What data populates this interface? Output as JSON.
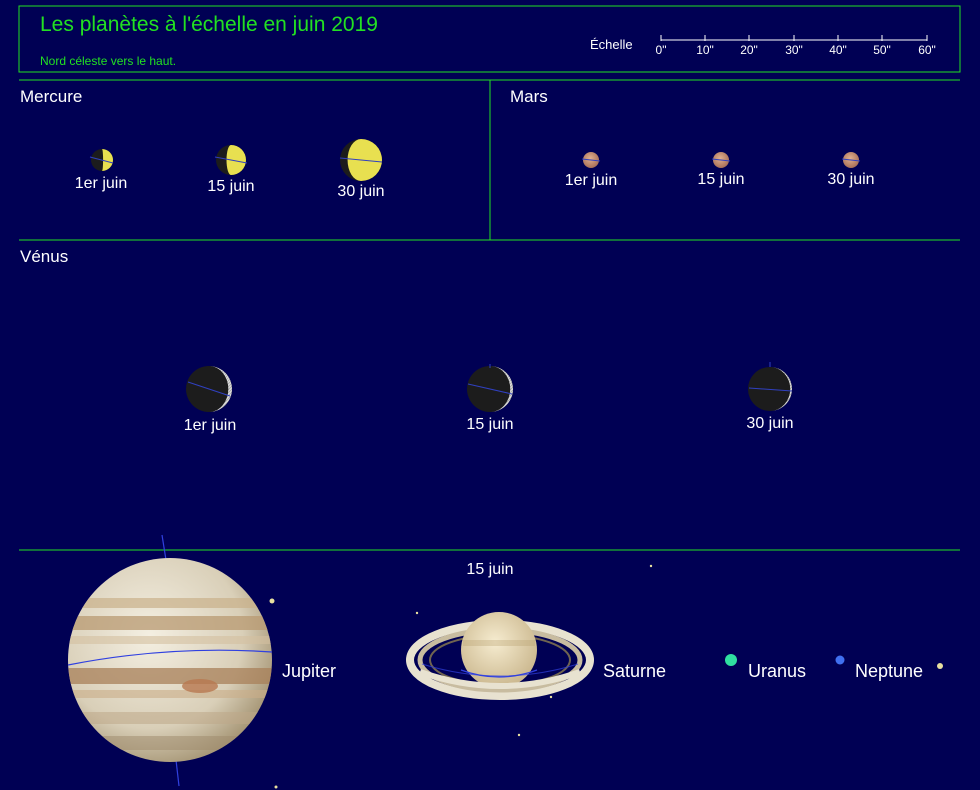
{
  "header": {
    "title": "Les planètes à l'échelle en juin 2019",
    "subtitle": "Nord céleste vers le haut.",
    "scale_label": "Échelle",
    "scale_ticks": [
      "0\"",
      "10\"",
      "20\"",
      "30\"",
      "40\"",
      "50\"",
      "60\""
    ]
  },
  "colors": {
    "background": "#000054",
    "frame": "#22e022",
    "mercury": "#e8e050",
    "mars": "#c89070",
    "venus": "#f2f2f2",
    "uranus": "#30e0a0",
    "neptune": "#4070f0"
  },
  "panels": {
    "mercury": {
      "label": "Mercure",
      "dates": [
        "1er juin",
        "15 juin",
        "30 juin"
      ],
      "illumination": [
        0.55,
        0.35,
        0.18
      ]
    },
    "mars": {
      "label": "Mars",
      "dates": [
        "1er juin",
        "15 juin",
        "30 juin"
      ]
    },
    "venus": {
      "label": "Vénus",
      "dates": [
        "1er juin",
        "15 juin",
        "30 juin"
      ],
      "illumination": [
        0.92,
        0.94,
        0.96
      ]
    },
    "outer": {
      "date": "15 juin",
      "jupiter": "Jupiter",
      "saturn": "Saturne",
      "uranus": "Uranus",
      "neptune": "Neptune"
    }
  }
}
